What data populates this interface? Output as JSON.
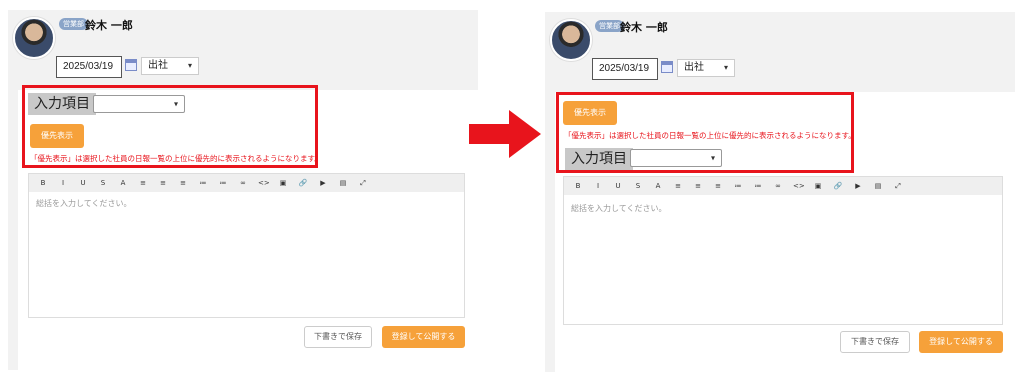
{
  "user": {
    "dept_badge": "営業部",
    "name": "鈴木 一郎"
  },
  "report": {
    "date": "2025/03/19",
    "status": "出社"
  },
  "fields": {
    "input_item_label": "入力項目",
    "priority_button": "優先表示",
    "priority_notice": "「優先表示」は選択した社員の日報一覧の上位に優先的に表示されるようになります。"
  },
  "editor": {
    "toolbar": [
      "B",
      "I",
      "U",
      "S",
      "A",
      "≡",
      "≡",
      "≡",
      "≔",
      "≔",
      "∞",
      "<>",
      "▣",
      "🔗",
      "▶",
      "▤",
      "⤢"
    ],
    "placeholder": "総括を入力してください。"
  },
  "actions": {
    "draft": "下書きで保存",
    "publish": "登録して公開する"
  },
  "colors": {
    "accent_orange": "#f6a13a",
    "highlight_red": "#e8141c"
  }
}
